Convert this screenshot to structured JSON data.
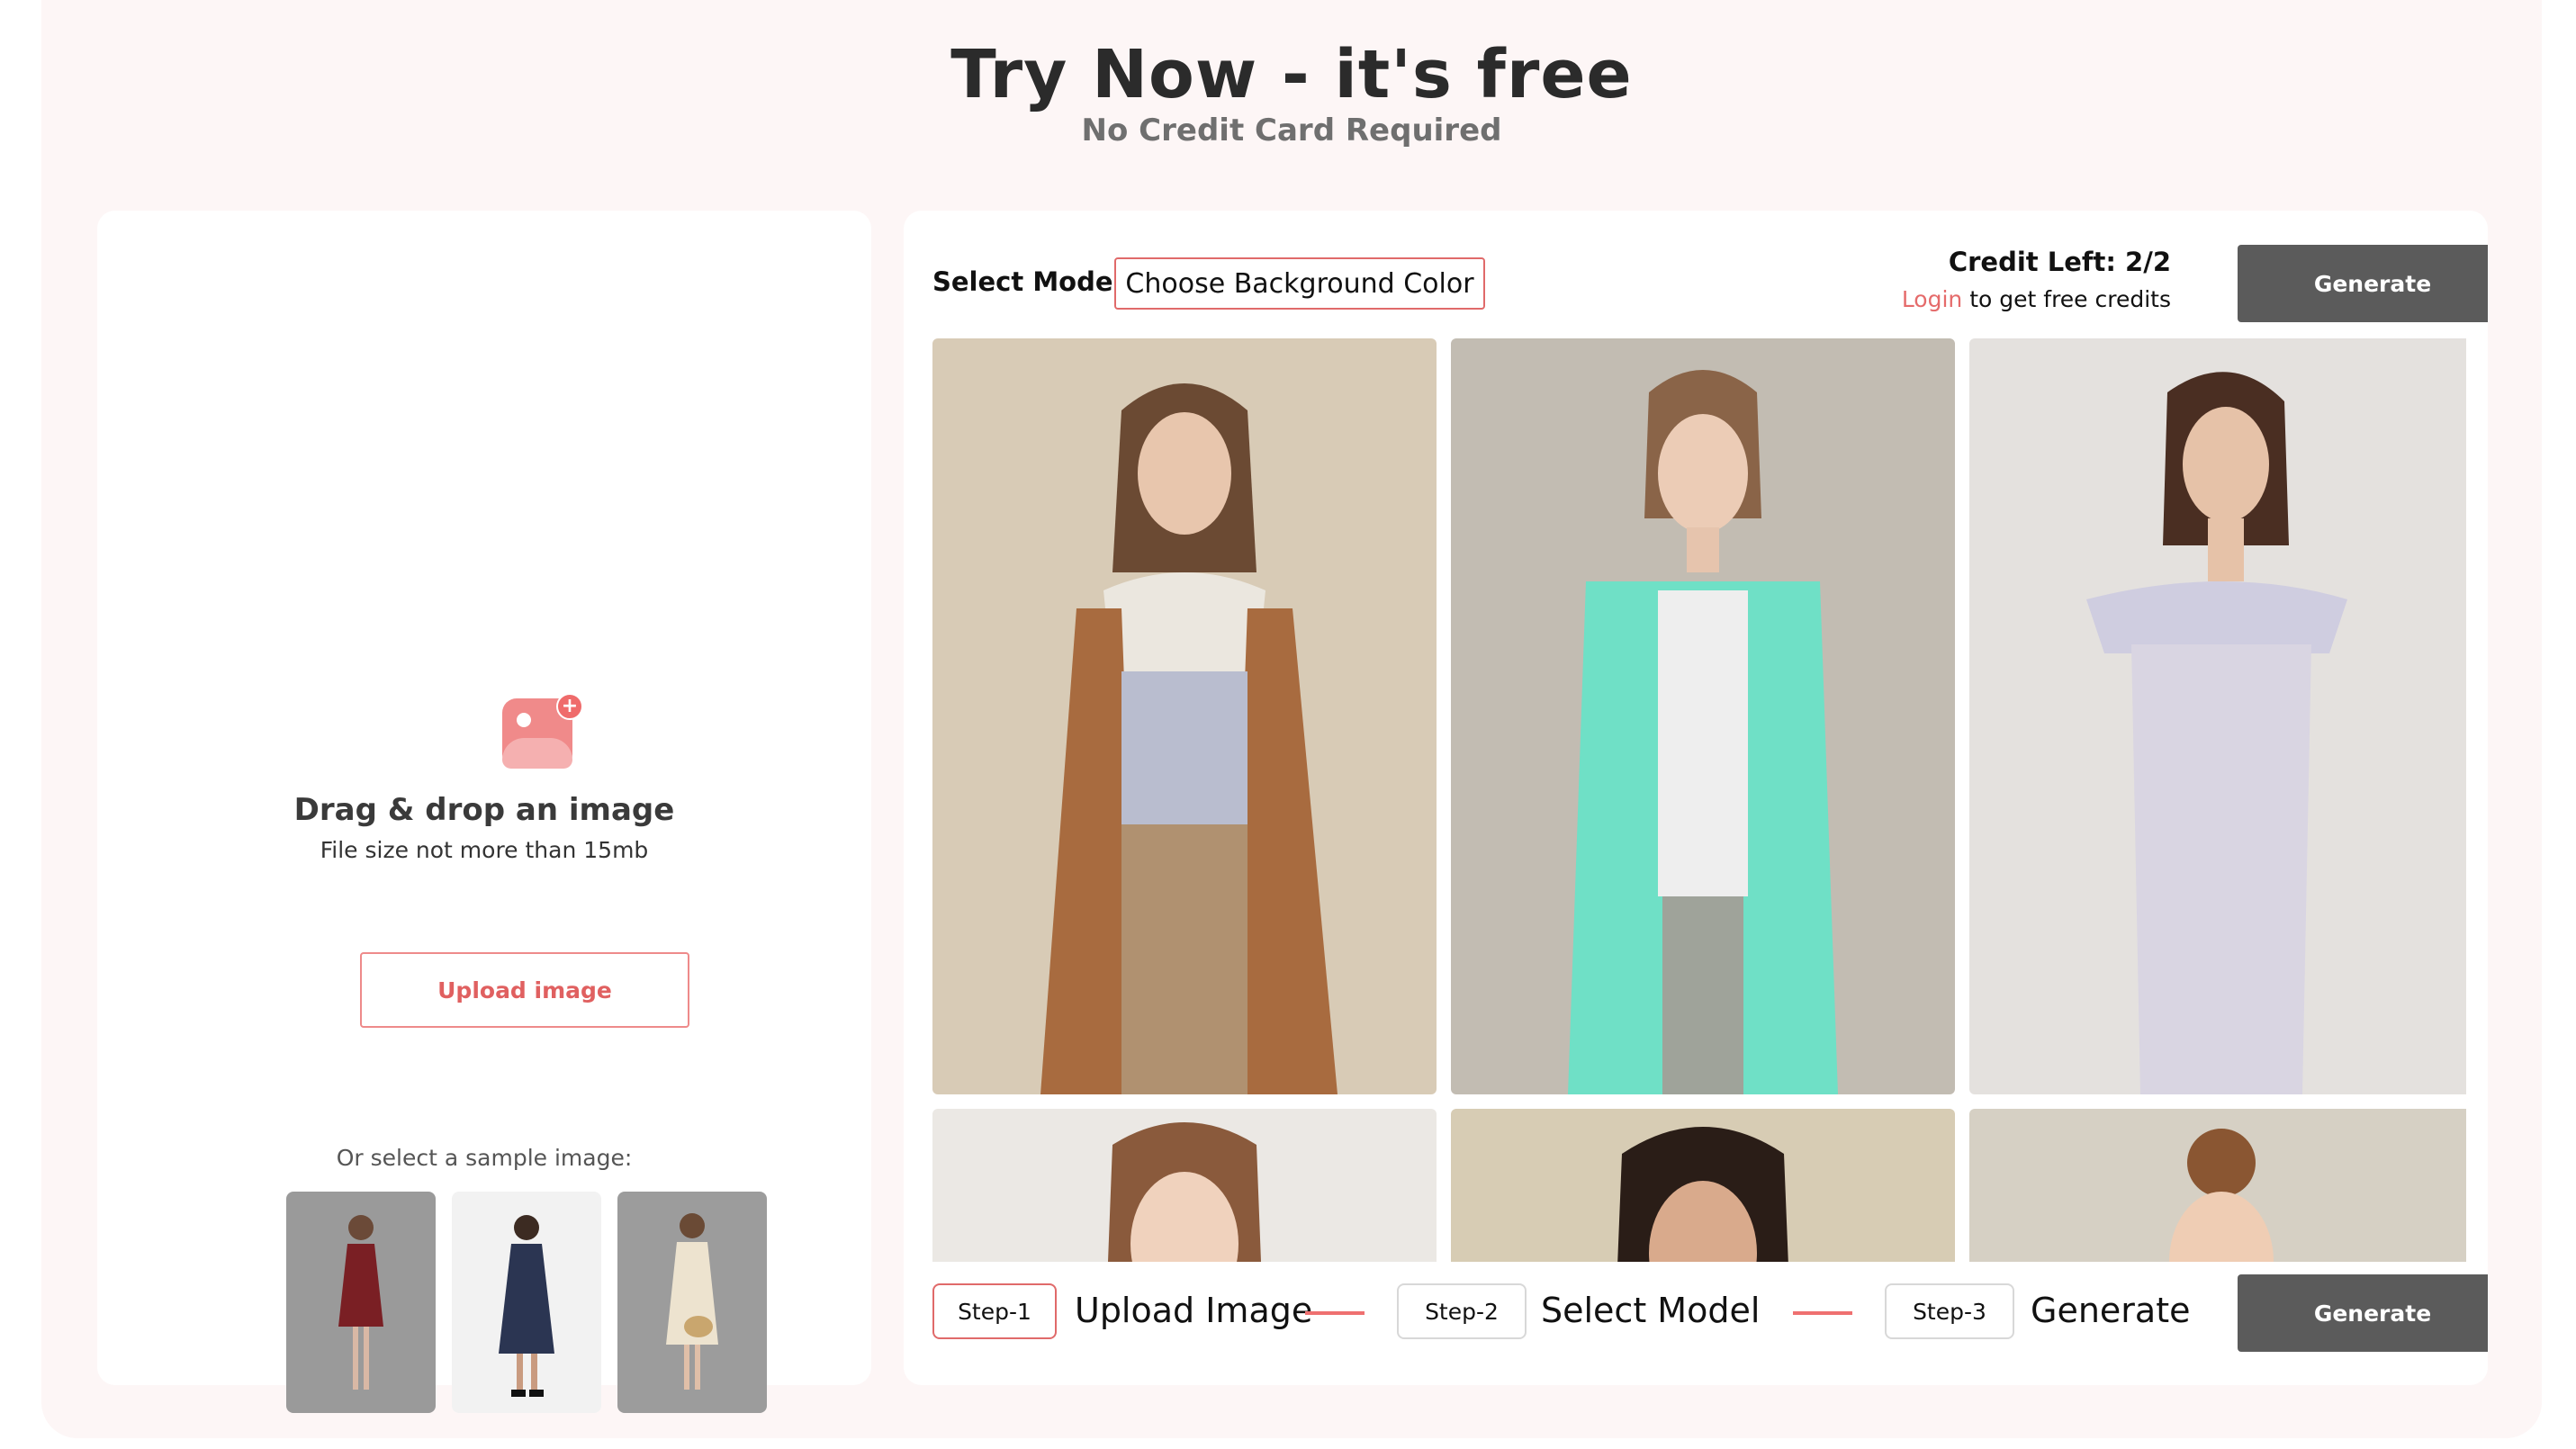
{
  "header": {
    "title": "Try Now - it's free",
    "subtitle": "No Credit Card Required"
  },
  "upload": {
    "icon": "image-add-icon",
    "title": "Drag & drop an image",
    "subtitle": "File size not more than 15mb",
    "button_label": "Upload image",
    "sample_label": "Or select a sample image:",
    "samples": [
      {
        "name": "sample-red-dress"
      },
      {
        "name": "sample-navy-dress"
      },
      {
        "name": "sample-cream-dress"
      }
    ]
  },
  "toolbar": {
    "select_model_label": "Select Model",
    "bg_color_button": "Choose Background Color",
    "credit_text": "Credit Left: 2/2",
    "login_link": "Login",
    "login_suffix": "to get free credits",
    "generate_label": "Generate"
  },
  "models": [
    {
      "name": "model-brown-coat"
    },
    {
      "name": "model-mint-blazer"
    },
    {
      "name": "model-lilac-dress"
    },
    {
      "name": "model-4"
    },
    {
      "name": "model-5"
    },
    {
      "name": "model-6"
    }
  ],
  "steps": [
    {
      "badge": "Step-1",
      "label": "Upload Image"
    },
    {
      "badge": "Step-2",
      "label": "Select Model"
    },
    {
      "badge": "Step-3",
      "label": "Generate"
    }
  ],
  "colors": {
    "accent": "#e06a6a",
    "generate_bg": "#5b5b5b",
    "page_bg": "#fdf6f6"
  }
}
